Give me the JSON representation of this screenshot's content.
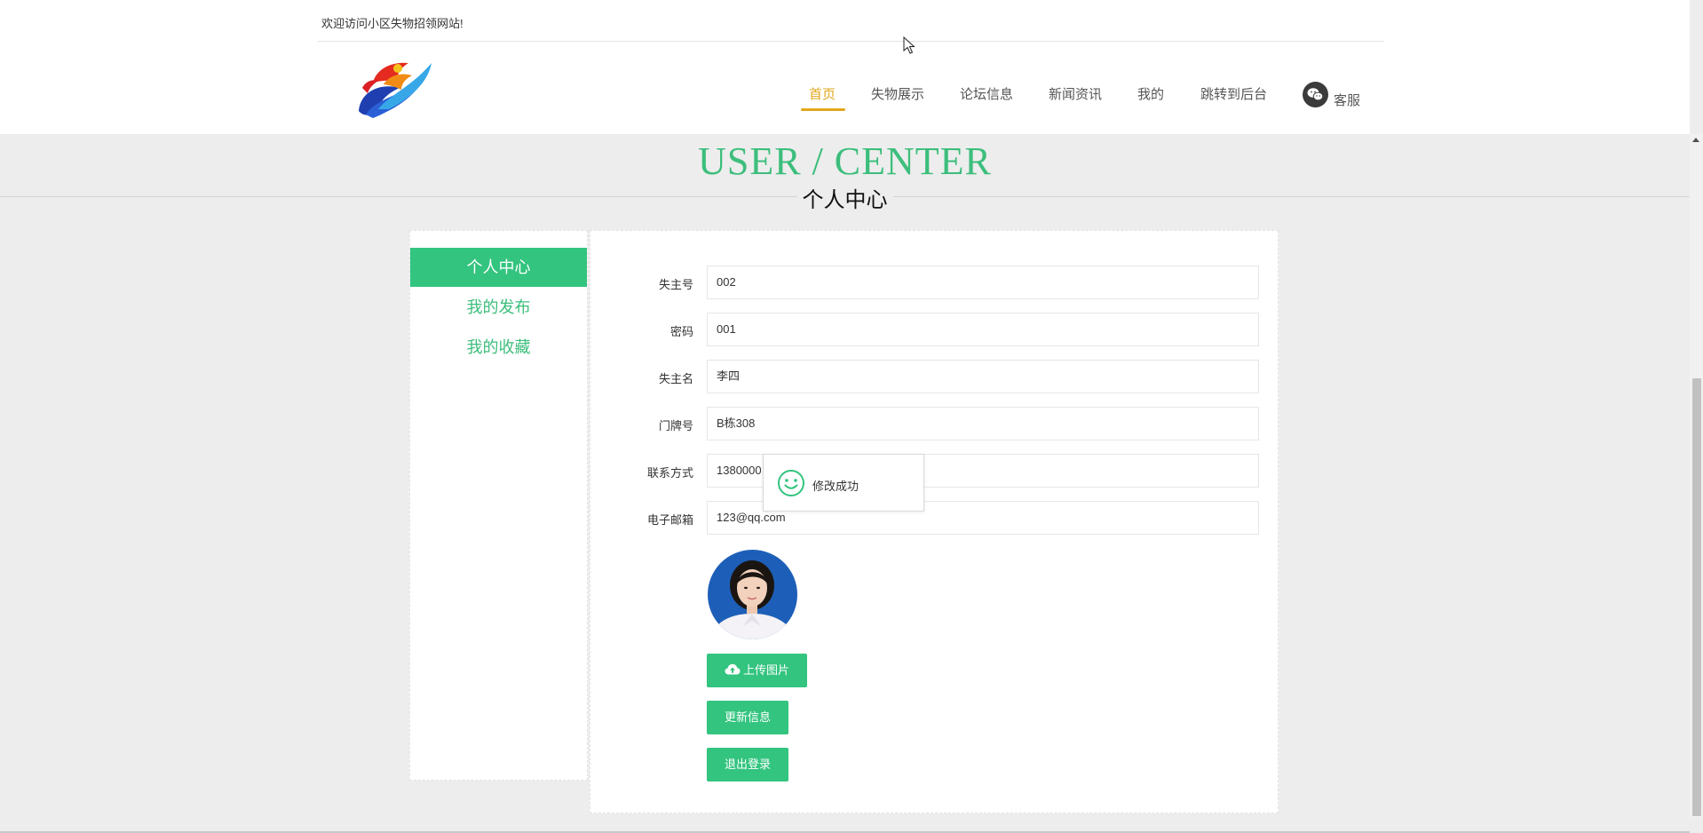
{
  "header": {
    "welcome": "欢迎访问小区失物招领网站!",
    "logo_icon": "flame-logo-icon"
  },
  "nav": {
    "items": [
      {
        "label": "首页",
        "active": true
      },
      {
        "label": "失物展示"
      },
      {
        "label": "论坛信息"
      },
      {
        "label": "新闻资讯"
      },
      {
        "label": "我的"
      },
      {
        "label": "跳转到后台"
      }
    ],
    "service": {
      "label": "客服",
      "icon": "wechat-icon"
    }
  },
  "banner": {
    "title": "USER / CENTER",
    "subtitle": "个人中心"
  },
  "sidebar": {
    "items": [
      {
        "label": "个人中心",
        "active": true
      },
      {
        "label": "我的发布"
      },
      {
        "label": "我的收藏"
      }
    ]
  },
  "form": {
    "fields": [
      {
        "label": "失主号",
        "value": "002"
      },
      {
        "label": "密码",
        "value": "001"
      },
      {
        "label": "失主名",
        "value": "李四"
      },
      {
        "label": "门牌号",
        "value": "B栋308"
      },
      {
        "label": "联系方式",
        "value": "1380000"
      },
      {
        "label": "电子邮箱",
        "value": "123@qq.com"
      }
    ],
    "upload_label": "上传图片",
    "update_label": "更新信息",
    "logout_label": "退出登录"
  },
  "toast": {
    "message": "修改成功",
    "icon": "smile-icon"
  },
  "colors": {
    "accent": "#33c47f",
    "nav_active": "#e2a71c"
  }
}
